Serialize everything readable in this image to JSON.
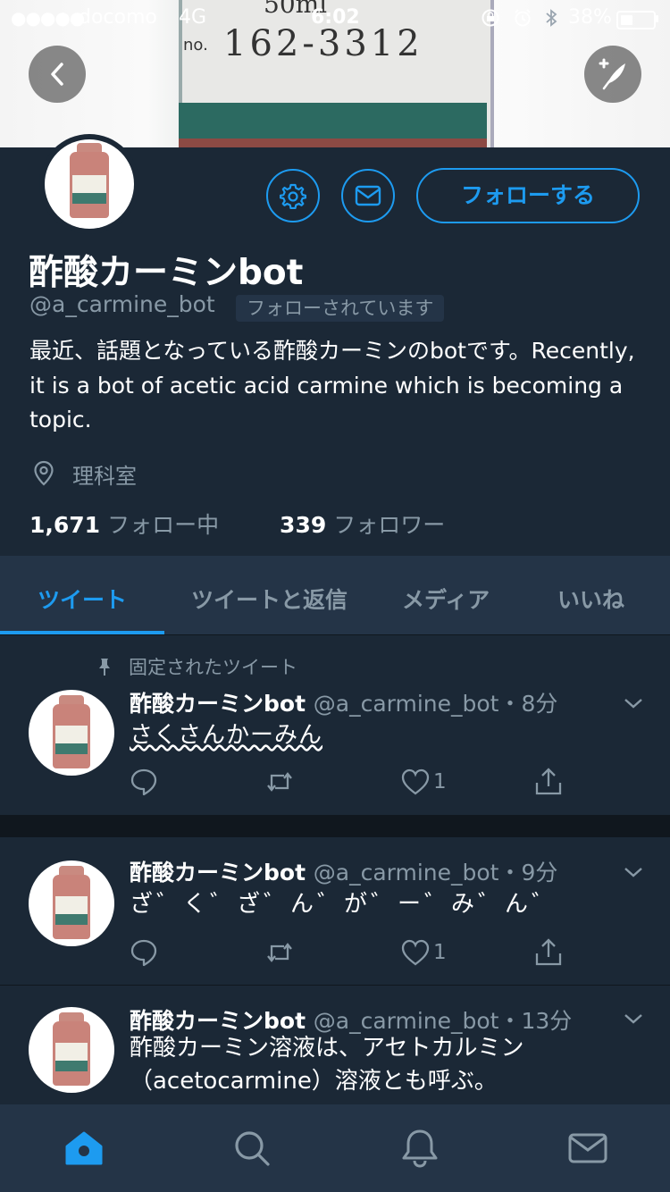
{
  "status_bar": {
    "carrier": "docomo",
    "network": "4G",
    "time": "6:02",
    "battery": "38%",
    "battery_level": 0.38
  },
  "banner": {
    "bottle_label_volume": "50ml",
    "bottle_label_code": "162-3312",
    "bottle_label_no": "no."
  },
  "profile": {
    "name": "酢酸カーミンbot",
    "handle": "@a_carmine_bot",
    "follows_you": "フォローされています",
    "bio": "最近、話題となっている酢酸カーミンのbotです。Recently, it is a bot of acetic acid carmine which is becoming a topic.",
    "location": "理科室",
    "following_count": "1,671",
    "following_label": "フォロー中",
    "followers_count": "339",
    "followers_label": "フォロワー",
    "follow_button": "フォローする"
  },
  "tabs": [
    {
      "label": "ツイート",
      "active": true
    },
    {
      "label": "ツイートと返信",
      "active": false
    },
    {
      "label": "メディア",
      "active": false
    },
    {
      "label": "いいね",
      "active": false
    }
  ],
  "pinned_label": "固定されたツイート",
  "tweets": [
    {
      "name": "酢酸カーミンbot",
      "handle": "@a_carmine_bot",
      "time": "・8分",
      "text": "さくさんかーみん",
      "likes": "1"
    },
    {
      "name": "酢酸カーミンbot",
      "handle": "@a_carmine_bot",
      "time": "・9分",
      "text": "ざ゛く゛ざ゛ん゛が゛ー゛み゛ん゛",
      "likes": "1"
    },
    {
      "name": "酢酸カーミンbot",
      "handle": "@a_carmine_bot",
      "time": "・13分",
      "text": "酢酸カーミン溶液は、アセトカルミン（acetocarmine）溶液とも呼ぶ。"
    }
  ],
  "colors": {
    "background": "#1b2836",
    "accent": "#1d9bf0",
    "secondary_text": "#8899a6",
    "bar": "#243447"
  },
  "icons": [
    "back-icon",
    "compose-icon",
    "gear-icon",
    "mail-icon",
    "location-icon",
    "pin-icon",
    "reply-icon",
    "retweet-icon",
    "heart-icon",
    "share-icon",
    "chevron-down-icon",
    "home-icon",
    "search-icon",
    "notifications-icon",
    "messages-icon"
  ]
}
